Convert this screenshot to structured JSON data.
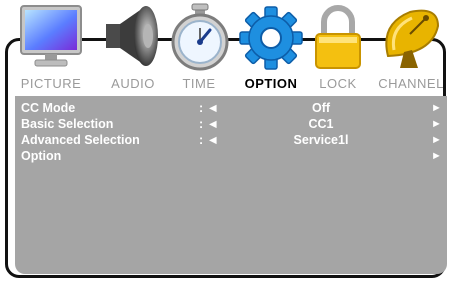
{
  "tabs": [
    {
      "label": "PICTURE",
      "icon": "monitor-icon"
    },
    {
      "label": "AUDIO",
      "icon": "speaker-icon"
    },
    {
      "label": "TIME",
      "icon": "stopwatch-icon"
    },
    {
      "label": "OPTION",
      "icon": "gear-icon",
      "active": true
    },
    {
      "label": "LOCK",
      "icon": "padlock-icon"
    },
    {
      "label": "CHANNEL",
      "icon": "satellite-dish-icon"
    }
  ],
  "rows": [
    {
      "name": "CC Mode",
      "sep": ": ◄",
      "value": "Off",
      "arrow": "►"
    },
    {
      "name": "Basic Selection",
      "sep": ": ◄",
      "value": "CC1",
      "arrow": "►"
    },
    {
      "name": "Advanced Selection",
      "sep": ": ◄",
      "value": "Service1l",
      "arrow": "►"
    },
    {
      "name": "Option",
      "sep": "",
      "value": "",
      "arrow": "►"
    }
  ],
  "colors": {
    "panel": "#a5a5a5",
    "active_label": "#000000",
    "inactive_label": "#9a9a9a",
    "gear": "#1e8fe0",
    "lock": "#f4c010",
    "dish": "#e8b400"
  }
}
